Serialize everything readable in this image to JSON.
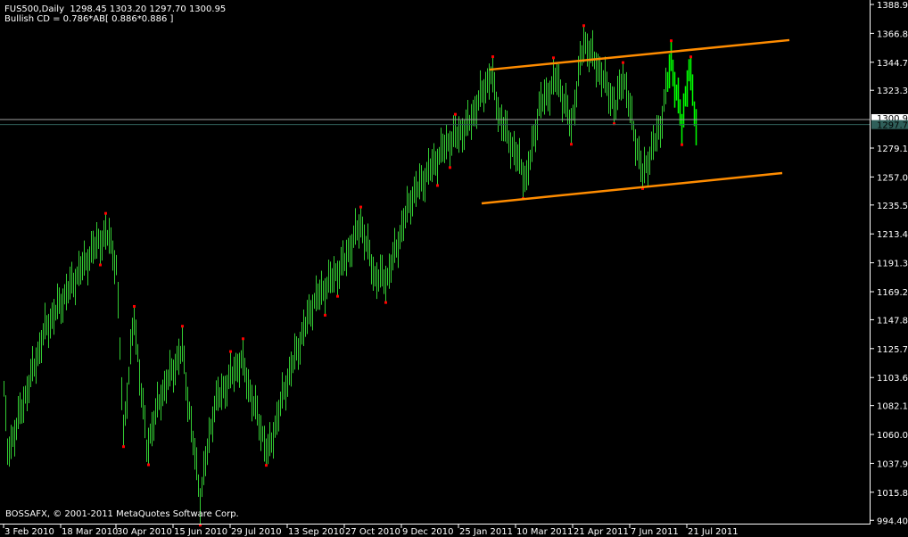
{
  "header": {
    "symbol_line": "FUS500,Daily  1298.45 1303.20 1297.70 1300.95",
    "pattern_line": "Bullish CD = 0.786*AB[ 0.886*0.886 ]"
  },
  "footer": {
    "copyright": "BOSSAFX, © 2001-2011 MetaQuotes Software Corp."
  },
  "colors": {
    "background": "#000000",
    "bars": "#33cc33",
    "pattern_bars": "#00ff00",
    "fractals": "#ff0000",
    "channel": "#ff8c00",
    "bid_line": "#a0a0a0",
    "ask_line": "#2f5f5a",
    "axis": "#ffffff"
  },
  "chart_data": {
    "type": "bar",
    "title": "FUS500,Daily",
    "ylim": [
      994.4,
      1388.95
    ],
    "yticks": [
      1388.95,
      1366.85,
      1344.75,
      1323.3,
      1279.1,
      1257.0,
      1235.55,
      1213.45,
      1191.35,
      1169.25,
      1147.8,
      1125.7,
      1103.6,
      1082.15,
      1060.05,
      1037.95,
      1015.85,
      994.4
    ],
    "current_price_labels": [
      "1300.95",
      "1297.74"
    ],
    "current_prices": [
      1300.95,
      1297.74
    ],
    "xticks": [
      {
        "bar": 0,
        "label": "3 Feb 2010"
      },
      {
        "bar": 32,
        "label": "18 Mar 2010"
      },
      {
        "bar": 63,
        "label": "30 Apr 2010"
      },
      {
        "bar": 95,
        "label": "15 Jun 2010"
      },
      {
        "bar": 127,
        "label": "29 Jul 2010"
      },
      {
        "bar": 159,
        "label": "13 Sep 2010"
      },
      {
        "bar": 191,
        "label": "27 Oct 2010"
      },
      {
        "bar": 223,
        "label": "9 Dec 2010"
      },
      {
        "bar": 255,
        "label": "25 Jan 2011"
      },
      {
        "bar": 287,
        "label": "10 Mar 2011"
      },
      {
        "bar": 319,
        "label": "21 Apr 2011"
      },
      {
        "bar": 351,
        "label": "7 Jun 2011"
      },
      {
        "bar": 383,
        "label": "21 Jul 2011"
      }
    ],
    "price_path": [
      [
        0,
        1095
      ],
      [
        2,
        1045
      ],
      [
        8,
        1071
      ],
      [
        23,
        1140
      ],
      [
        38,
        1175
      ],
      [
        53,
        1208
      ],
      [
        59,
        1212
      ],
      [
        63,
        1188
      ],
      [
        67,
        1062
      ],
      [
        73,
        1150
      ],
      [
        80,
        1050
      ],
      [
        88,
        1090
      ],
      [
        100,
        1125
      ],
      [
        105,
        1065
      ],
      [
        110,
        1012
      ],
      [
        118,
        1083
      ],
      [
        133,
        1117
      ],
      [
        148,
        1045
      ],
      [
        158,
        1098
      ],
      [
        173,
        1160
      ],
      [
        190,
        1190
      ],
      [
        200,
        1222
      ],
      [
        208,
        1180
      ],
      [
        215,
        1180
      ],
      [
        228,
        1240
      ],
      [
        248,
        1282
      ],
      [
        260,
        1296
      ],
      [
        273,
        1336
      ],
      [
        278,
        1302
      ],
      [
        293,
        1255
      ],
      [
        300,
        1310
      ],
      [
        310,
        1333
      ],
      [
        318,
        1296
      ],
      [
        325,
        1361
      ],
      [
        333,
        1341
      ],
      [
        343,
        1310
      ],
      [
        347,
        1336
      ],
      [
        358,
        1258
      ],
      [
        368,
        1296
      ],
      [
        374,
        1347
      ],
      [
        380,
        1296
      ],
      [
        384,
        1341
      ],
      [
        388,
        1297
      ]
    ],
    "pattern_start_bar": 372,
    "channel_upper": [
      [
        272.5,
        1339.1
      ],
      [
        440.5,
        1361.7
      ]
    ],
    "channel_lower": [
      [
        268,
        1236.8
      ],
      [
        436.5,
        1260.0
      ]
    ]
  }
}
